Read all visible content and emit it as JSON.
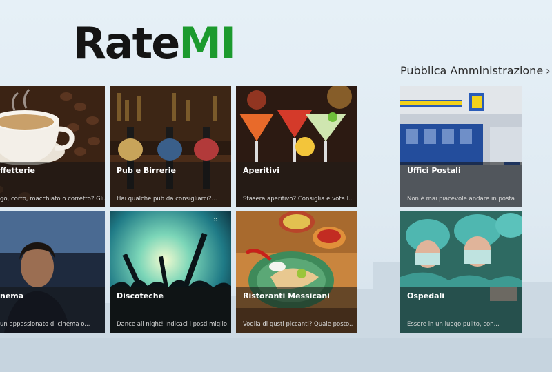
{
  "app": {
    "logo_part1": "Rate",
    "logo_part2": "MI",
    "accent_green": "#1c9a2e"
  },
  "groups": [
    {
      "name": "",
      "tiles": [
        {
          "title": "ffetterie",
          "desc": "go, corto, macchiato o corretto? Gli...",
          "icon": "coffee-cup-icon"
        },
        {
          "title": "Pub e Birrerie",
          "desc": "Hai qualche pub da consigliarci?...",
          "icon": "beer-taps-icon"
        },
        {
          "title": "Aperitivi",
          "desc": "Stasera aperitivo? Consiglia e vota l...",
          "icon": "cocktail-icon"
        },
        {
          "title": "nema",
          "desc": "un appassionato di cinema o...",
          "icon": "cinema-icon"
        },
        {
          "title": "Discoteche",
          "desc": "Dance all night! Indicaci i posti migliori...",
          "icon": "disco-icon"
        },
        {
          "title": "Ristoranti Messicani",
          "desc": "Voglia di gusti piccanti? Quale posto...",
          "icon": "mexican-food-icon"
        }
      ]
    },
    {
      "name": "Pubblica Amministrazione",
      "tiles": [
        {
          "title": "Uffici Postali",
          "desc": "Non è mai piacevole andare in posta a...",
          "icon": "post-office-icon"
        },
        {
          "title": "Ospedali",
          "desc": "Essere in un luogo pulito, con...",
          "icon": "hospital-icon"
        }
      ]
    }
  ]
}
